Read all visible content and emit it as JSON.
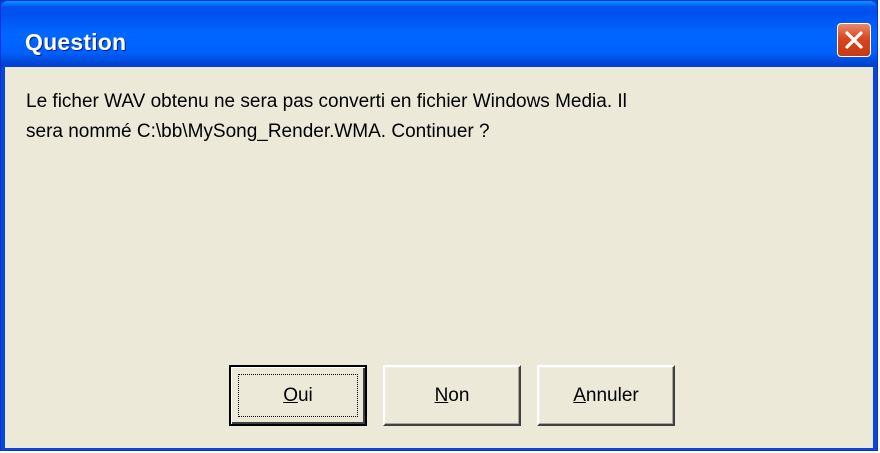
{
  "window": {
    "title": "Question",
    "close_icon": "close-icon"
  },
  "dialog": {
    "message_line1": "Le ficher WAV obtenu ne sera pas converti en fichier Windows Media. Il",
    "message_line2": "sera nommé C:\\bb\\MySong_Render.WMA. Continuer ?"
  },
  "buttons": {
    "oui": {
      "mnemonic": "O",
      "rest": "ui"
    },
    "non": {
      "mnemonic": "N",
      "rest": "on"
    },
    "annuler": {
      "mnemonic": "A",
      "rest": "nnuler"
    }
  },
  "colors": {
    "titlebar": "#0054e3",
    "close_button": "#d9471f",
    "client_background": "#ece9d8"
  }
}
